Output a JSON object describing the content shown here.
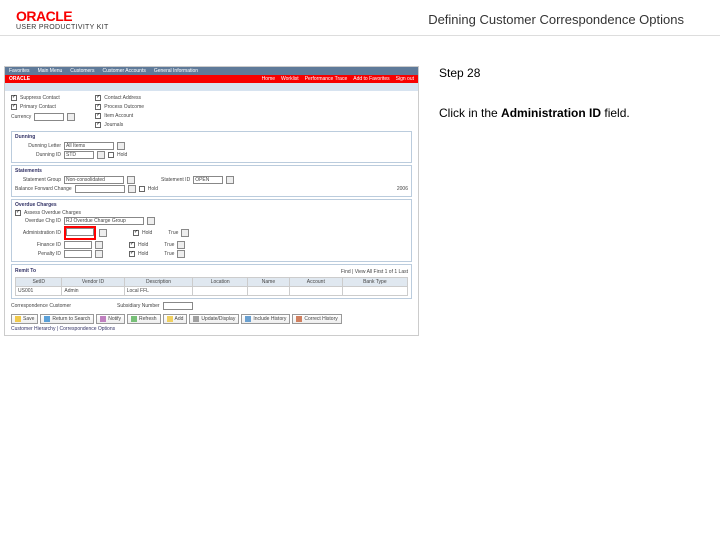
{
  "header": {
    "brand": "ORACLE",
    "brand_sub": "USER PRODUCTIVITY KIT",
    "page_title": "Defining Customer Correspondence Options"
  },
  "instructions": {
    "step_label": "Step 28",
    "action_pre": "Click in the ",
    "action_field": "Administration ID",
    "action_post": " field."
  },
  "app": {
    "topmenu": [
      "Favorites",
      "Main Menu",
      "Customers",
      "Customer Accounts",
      "General Information"
    ],
    "brand": "ORACLE",
    "rlinks": [
      "Home",
      "Worklist",
      "Performance Trace",
      "Add to Favorites",
      "Sign out"
    ],
    "subnav": "",
    "cust_opts": {
      "left": [
        {
          "label": "Suppress Contact",
          "on": true
        },
        {
          "label": "Primary Contact",
          "on": true
        },
        {
          "label": "Currency",
          "on": false
        }
      ],
      "right": [
        {
          "label": "Contact Address",
          "on": true
        },
        {
          "label": "Process Outcome",
          "on": true
        },
        {
          "label": "Item Account",
          "on": true
        },
        {
          "label": "Journals",
          "on": true
        }
      ],
      "currency_value": ""
    },
    "dunning": {
      "header": "Dunning",
      "letter_label": "Dunning Letter",
      "letter_value": "All Items",
      "id_label": "Dunning ID",
      "id_value": "STD",
      "hold_label": "Hold",
      "hold_on": false
    },
    "statements": {
      "header": "Statements",
      "group_label": "Statement Group",
      "group_value": "Non-consolidated",
      "id_label": "Statement ID",
      "id_value": "OPEN",
      "bal_label": "Balance Forward Change",
      "hold_label": "Hold",
      "hold_on": false,
      "right_value": "2006"
    },
    "overdue": {
      "header": "Overdue Charges",
      "assess_label": "Assess Overdue Charges",
      "assess_on": true,
      "rows": [
        {
          "label": "Overdue Chg ID",
          "value": "RJ Overdue Charge Group",
          "hold_lbl": "",
          "hold_on": false,
          "hold_value": ""
        },
        {
          "label": "Administration ID",
          "value": "",
          "hold_lbl": "Hold",
          "hold_on": true,
          "hold_value": "True"
        },
        {
          "label": "Finance ID",
          "value": "",
          "hold_lbl": "Hold",
          "hold_on": true,
          "hold_value": "True"
        },
        {
          "label": "Penalty ID",
          "value": "",
          "hold_lbl": "Hold",
          "hold_on": true,
          "hold_value": "True"
        }
      ]
    },
    "remit": {
      "header": "Remit To",
      "cols": [
        "SetID",
        "Vendor ID",
        "Description",
        "Location",
        "Name",
        "Account",
        "Bank Type"
      ],
      "row": [
        "US001",
        "Admin",
        "Local FFL",
        "",
        "",
        "",
        ""
      ],
      "find": "Find | View All",
      "count": "First 1 of 1 Last"
    },
    "corr": {
      "label": "Correspondence Customer",
      "sub": "Subsidiary Number"
    },
    "buttons": [
      {
        "name": "save-button",
        "label": "Save",
        "color": "#f0c94c"
      },
      {
        "name": "return-button",
        "label": "Return to Search",
        "color": "#5aa0d8"
      },
      {
        "name": "notify-button",
        "label": "Notify",
        "color": "#c080c0"
      },
      {
        "name": "refresh-button",
        "label": "Refresh",
        "color": "#78c078"
      },
      {
        "name": "add-button",
        "label": "Add",
        "color": "#f0d060"
      },
      {
        "name": "update-button",
        "label": "Update/Display",
        "color": "#a0a0a0"
      },
      {
        "name": "include-button",
        "label": "Include History",
        "color": "#6aa0d0"
      },
      {
        "name": "correct-button",
        "label": "Correct History",
        "color": "#d08060"
      }
    ],
    "crumb": "Customer Hierarchy | Correspondence Options"
  }
}
